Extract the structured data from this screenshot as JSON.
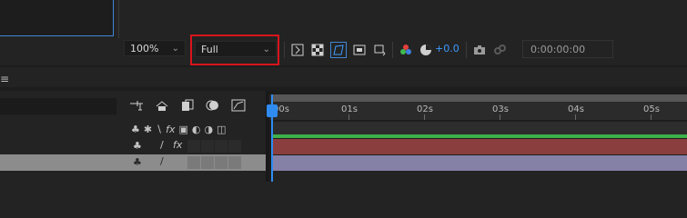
{
  "viewer": {
    "zoom_label": "100%",
    "resolution_label": "Full",
    "exposure_value": "+0.0",
    "timecode": "0:00:00:00"
  },
  "timeline": {
    "ruler_labels": [
      "00s",
      "01s",
      "02s",
      "03s",
      "04s",
      "05s"
    ]
  },
  "colors": {
    "accent": "#2f8bf0",
    "highlight": "#d9141c",
    "track_green": "#3db14a",
    "track_red": "#8a3e3e",
    "track_purple": "#8580a6"
  }
}
